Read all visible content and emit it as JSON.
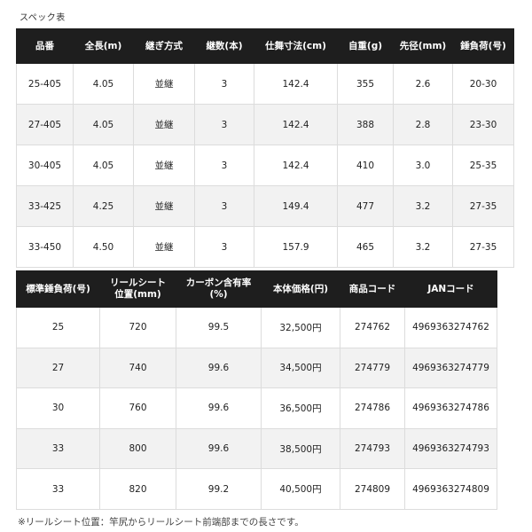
{
  "title": "スペック表",
  "table1": {
    "headers": [
      "品番",
      "全長(m)",
      "継ぎ方式",
      "継数(本)",
      "仕舞寸法(cm)",
      "自重(g)",
      "先径(mm)",
      "錘負荷(号)"
    ],
    "rows": [
      [
        "25-405",
        "4.05",
        "並継",
        "3",
        "142.4",
        "355",
        "2.6",
        "20-30"
      ],
      [
        "27-405",
        "4.05",
        "並継",
        "3",
        "142.4",
        "388",
        "2.8",
        "23-30"
      ],
      [
        "30-405",
        "4.05",
        "並継",
        "3",
        "142.4",
        "410",
        "3.0",
        "25-35"
      ],
      [
        "33-425",
        "4.25",
        "並継",
        "3",
        "149.4",
        "477",
        "3.2",
        "27-35"
      ],
      [
        "33-450",
        "4.50",
        "並継",
        "3",
        "157.9",
        "465",
        "3.2",
        "27-35"
      ]
    ]
  },
  "table2": {
    "headers": [
      "標準錘負荷(号)",
      "リールシート\n位置(mm)",
      "カーボン含有率\n(%)",
      "本体価格(円)",
      "商品コード",
      "JANコード"
    ],
    "rows": [
      [
        "25",
        "720",
        "99.5",
        "32,500円",
        "274762",
        "4969363274762"
      ],
      [
        "27",
        "740",
        "99.6",
        "34,500円",
        "274779",
        "4969363274779"
      ],
      [
        "30",
        "760",
        "99.6",
        "36,500円",
        "274786",
        "4969363274786"
      ],
      [
        "33",
        "800",
        "99.6",
        "38,500円",
        "274793",
        "4969363274793"
      ],
      [
        "33",
        "820",
        "99.2",
        "40,500円",
        "274809",
        "4969363274809"
      ]
    ]
  },
  "footnote": "※リールシート位置：竿尻からリールシート前端部までの長さです。"
}
